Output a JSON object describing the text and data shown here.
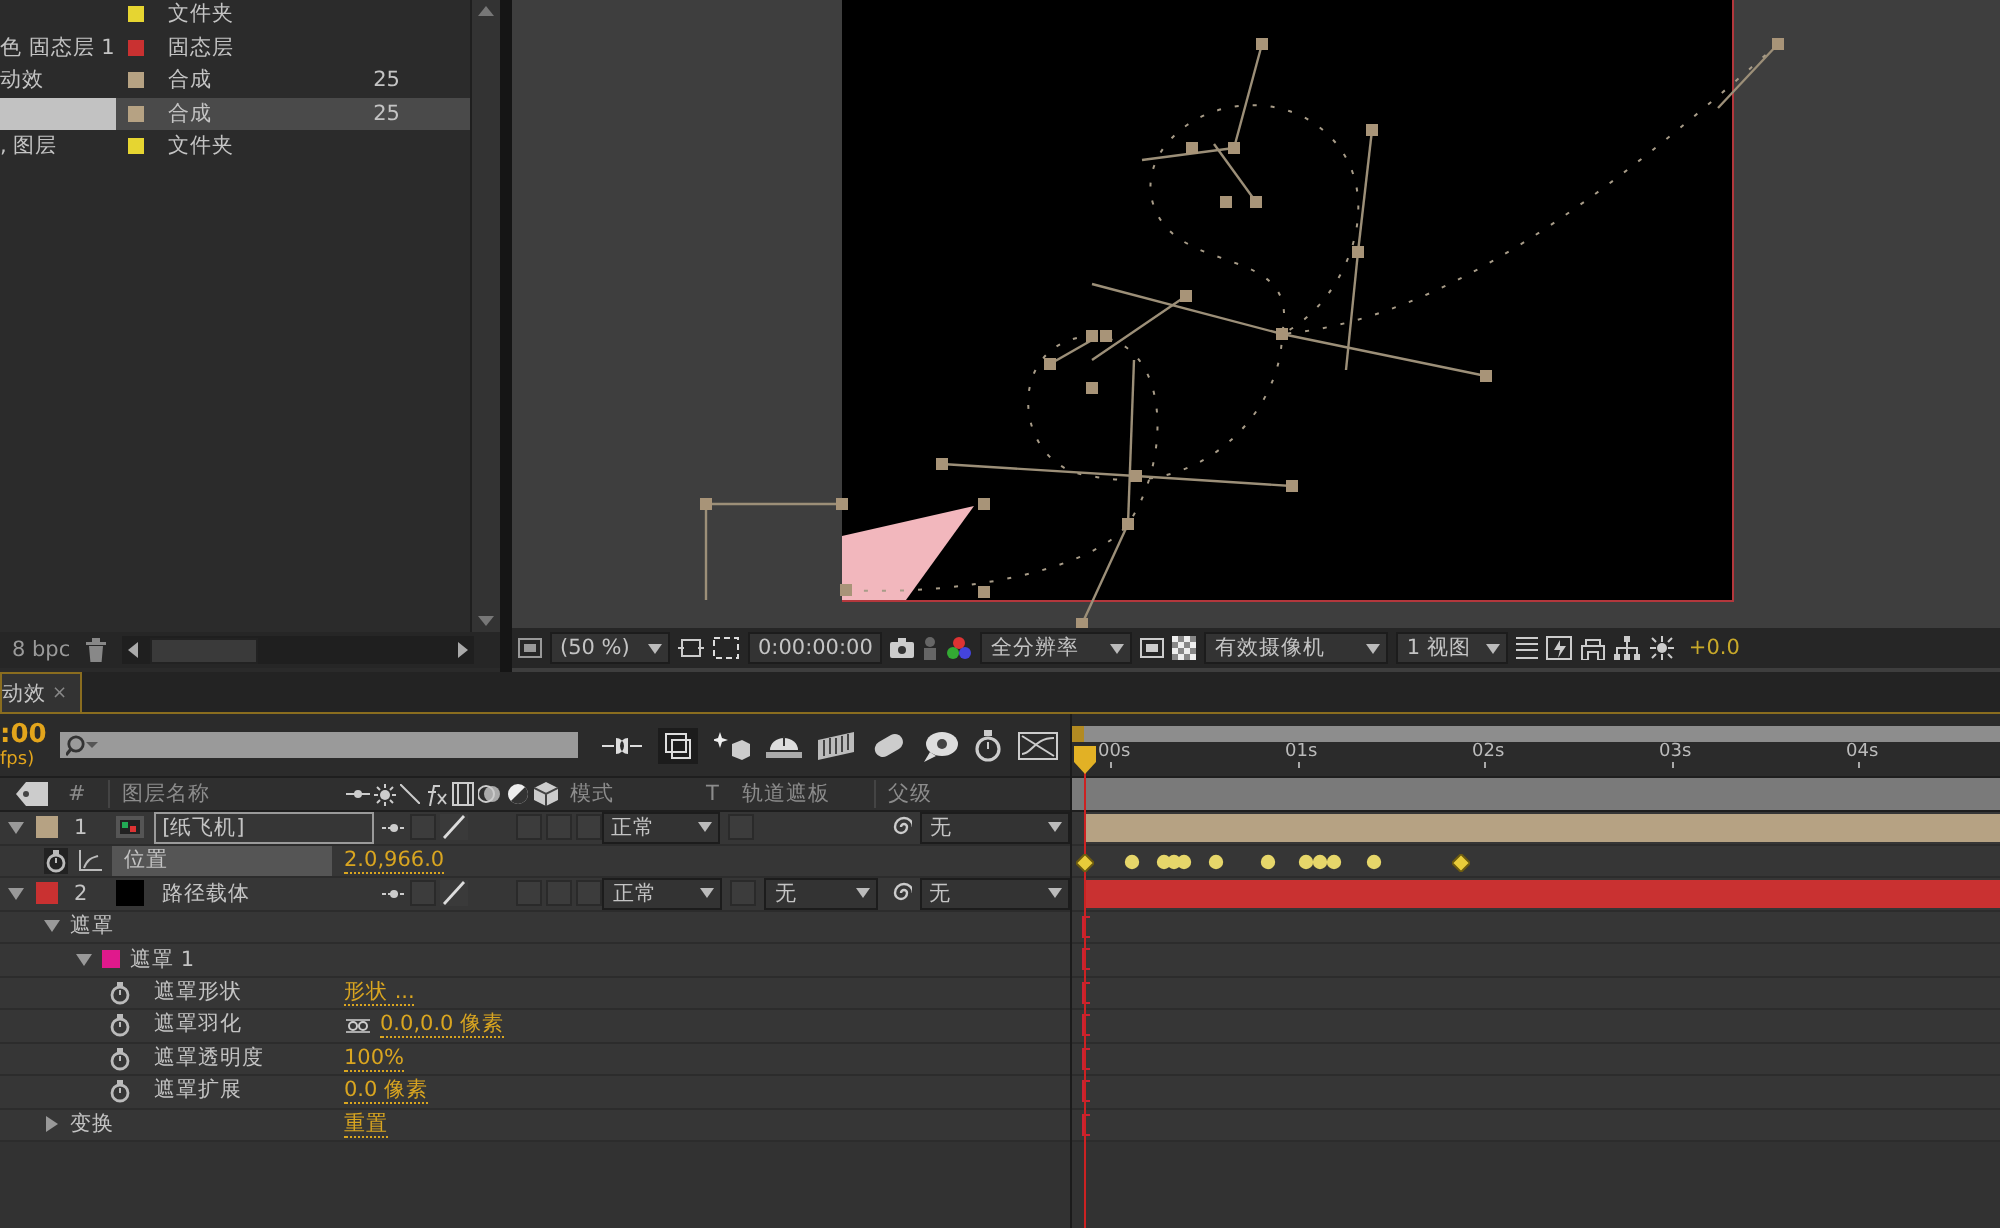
{
  "project": {
    "items": [
      {
        "type": "文件夹",
        "color": "#e6d531",
        "selected": false
      },
      {
        "name": "色 固态层 1",
        "type": "固态层",
        "color": "#c93131",
        "selected": false
      },
      {
        "name": "动效",
        "type": "合成",
        "size": "25",
        "color": "#b6a283",
        "selected": false
      },
      {
        "type": "合成",
        "size": "25",
        "color": "#b6a283",
        "selected": true
      },
      {
        "name": ", 图层",
        "type": "文件夹",
        "color": "#e6d531",
        "selected": false
      }
    ],
    "bit_depth": "8 bpc"
  },
  "viewer": {
    "zoom": "(50 %)",
    "timecode": "0:00:00:00",
    "resolution": "全分辨率",
    "camera": "有效摄像机",
    "views": "1 视图",
    "exposure": "+0.0"
  },
  "timeline": {
    "tab": {
      "label": "动效",
      "close": "×"
    },
    "time": ":00",
    "fps": "fps)",
    "columns": {
      "index": "#",
      "name": "图层名称",
      "mode": "模式",
      "t": "T",
      "track_matte": "轨道遮板",
      "parent": "父级"
    },
    "ruler": [
      "00s",
      "01s",
      "02s",
      "03s",
      "04s"
    ],
    "layers": [
      {
        "kind": "comp_layer",
        "index": "1",
        "name": "[纸飞机]",
        "color": "#b6a283",
        "expanded": true,
        "renaming": true,
        "switches": [
          false,
          false,
          false,
          false
        ],
        "preserve_transparency": false,
        "mode": "正常",
        "parent": "无",
        "children": [
          {
            "kind": "property",
            "name": "位置",
            "value": "2.0,966.0",
            "stopwatch": true,
            "selected": true
          }
        ]
      },
      {
        "kind": "solid_layer",
        "index": "2",
        "name": "路径载体",
        "color": "#c93131",
        "expanded": true,
        "renaming": false,
        "switches": [
          false,
          false,
          false,
          false
        ],
        "preserve_transparency": false,
        "mode": "正常",
        "track_matte": "无",
        "parent": "无",
        "children": [
          {
            "kind": "group",
            "name": "遮罩",
            "expanded": true,
            "children": [
              {
                "kind": "mask",
                "name": "遮罩 1",
                "color": "#e0198c",
                "expanded": true,
                "children": [
                  {
                    "kind": "property",
                    "name": "遮罩形状",
                    "value": "形状 ...",
                    "stopwatch": false,
                    "selected": false
                  },
                  {
                    "kind": "property",
                    "name": "遮罩羽化",
                    "value": "0.0,0.0 像素",
                    "linked": true,
                    "stopwatch": false,
                    "selected": false
                  },
                  {
                    "kind": "property",
                    "name": "遮罩透明度",
                    "value": "100%",
                    "stopwatch": false,
                    "selected": false
                  },
                  {
                    "kind": "property",
                    "name": "遮罩扩展",
                    "value": "0.0 像素",
                    "stopwatch": false,
                    "selected": false
                  }
                ]
              }
            ]
          },
          {
            "kind": "group",
            "name": "变换",
            "value": "重置",
            "expanded": false
          }
        ]
      }
    ]
  }
}
